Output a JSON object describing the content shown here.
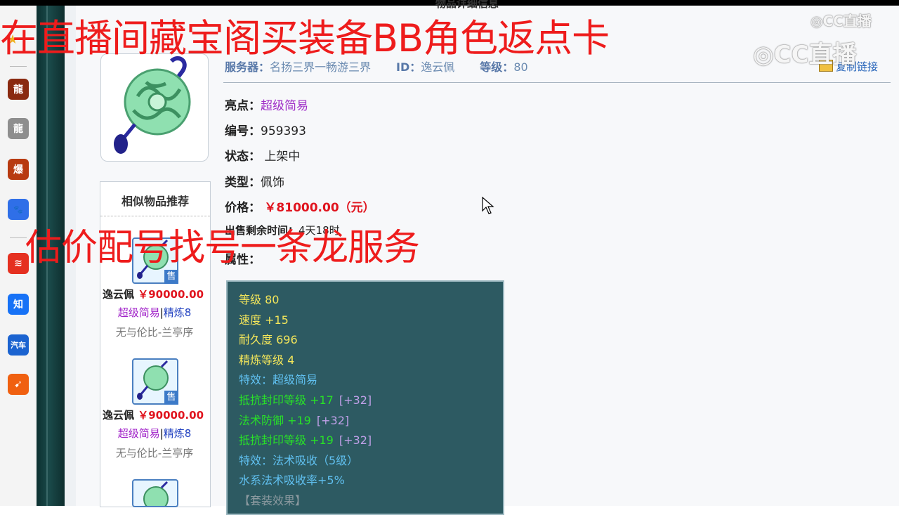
{
  "overlay": {
    "top_caption": "在直播间藏宝阁买装备BB角色返点卡",
    "mid_caption": "估价配号找号一条龙服务",
    "watermark_small": "CC直播",
    "watermark_large": "CC直播"
  },
  "sidebar": {
    "apps": [
      {
        "icon": "dragon-game-icon",
        "glyph": "龍",
        "color": "#8a2a10"
      },
      {
        "icon": "long-app-icon",
        "glyph": "龍",
        "color": "#8e8e8e"
      },
      {
        "icon": "blast-game-icon",
        "glyph": "爆",
        "color": "#b83a10"
      },
      {
        "icon": "baidu-paw-icon",
        "glyph": "🐾",
        "color": "#2f6fe8"
      },
      {
        "icon": "swoosh-app-icon",
        "glyph": "≋",
        "color": "#e53020"
      },
      {
        "icon": "zhihu-icon",
        "glyph": "知",
        "color": "#1772f6"
      },
      {
        "icon": "autohome-icon",
        "glyph": "汽车",
        "color": "#1b63d0"
      },
      {
        "icon": "plane-app-icon",
        "glyph": "➹",
        "color": "#f06010"
      }
    ]
  },
  "header": {
    "server_label": "服务器：",
    "server_value": "名扬三界一畅游三界",
    "id_label": "ID：",
    "id_value": "逸云佩",
    "level_label": "等级：",
    "level_value": "80",
    "copy_link": "复制链接",
    "top_cut": "物品详细信息"
  },
  "details": {
    "highlight_label": "亮点：",
    "highlight_value": "超级简易",
    "number_label": "编号：",
    "number_value": "959393",
    "status_label": "状态：",
    "status_value": "上架中",
    "type_label": "类型：",
    "type_value": "佩饰",
    "price_label": "价格：",
    "price_value": "￥81000.00（元）",
    "time_label": "出售剩余时间：",
    "time_value": "4天18时",
    "attr_label": "属性："
  },
  "attributes": [
    {
      "text": "等级 80",
      "color": "y"
    },
    {
      "text": "速度 +15",
      "color": "y"
    },
    {
      "text": "耐久度 696",
      "color": "y"
    },
    {
      "text": "精炼等级 4",
      "color": "y"
    },
    {
      "text": "特效：超级简易",
      "color": "b"
    },
    {
      "text": "抵抗封印等级 +17",
      "extra": "[+32]",
      "color": "g"
    },
    {
      "text": "法术防御 +19",
      "extra": "[+32]",
      "color": "g"
    },
    {
      "text": "抵抗封印等级 +19",
      "extra": "[+32]",
      "color": "g"
    },
    {
      "text": "特效：法术吸收（5级）",
      "color": "b"
    },
    {
      "text": "水系法术吸收率+5%",
      "color": "b"
    },
    {
      "text": "【套装效果】",
      "color": "gr"
    }
  ],
  "similar": {
    "title": "相似物品推荐",
    "items": [
      {
        "name": "逸云佩",
        "price": "￥90000.00",
        "tag1": "超级简易",
        "sep": "|",
        "tag2": "精炼8",
        "server": "无与伦比-兰亭序",
        "sell": "售"
      },
      {
        "name": "逸云佩",
        "price": "￥90000.00",
        "tag1": "超级简易",
        "sep": "|",
        "tag2": "精炼8",
        "server": "无与伦比-兰亭序",
        "sell": "售"
      }
    ]
  }
}
